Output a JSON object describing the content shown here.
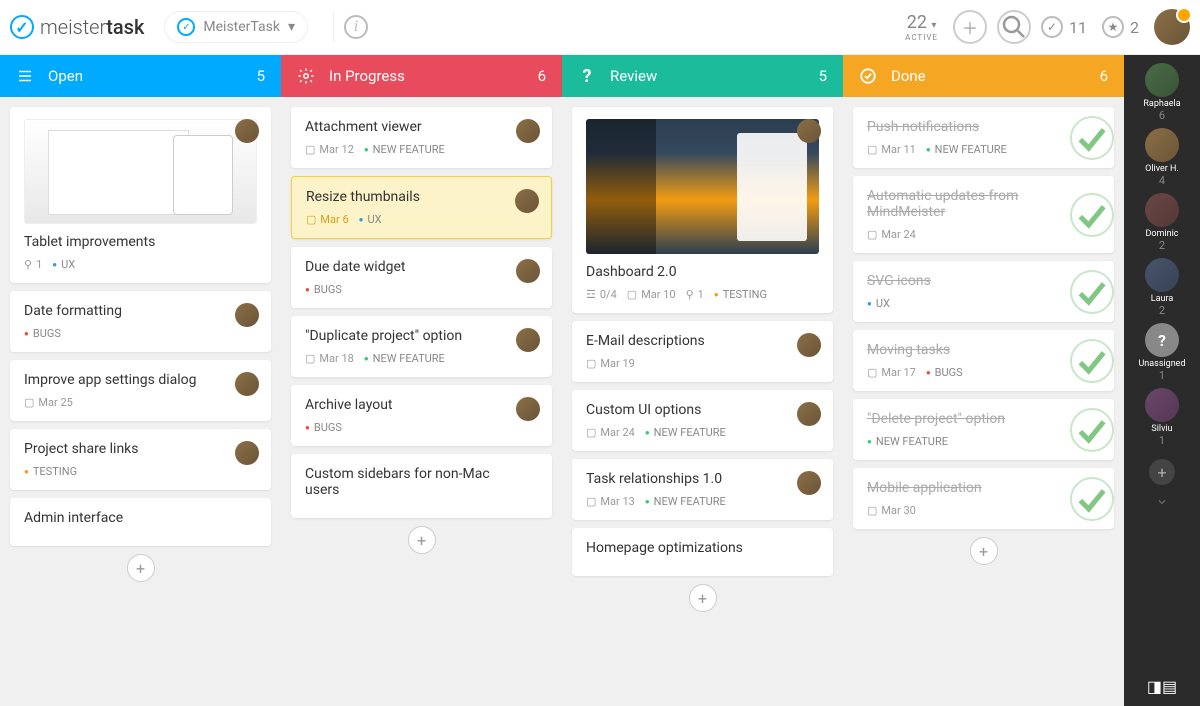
{
  "header": {
    "logo_pre": "meister",
    "logo_post": "task",
    "project_name": "MeisterTask",
    "active_count": "22",
    "active_label": "ACTIVE",
    "done_count": "11",
    "star_count": "2"
  },
  "columns": [
    {
      "title": "Open",
      "count": "5",
      "color": "#00aaff",
      "icon": "list",
      "cards": [
        {
          "title": "Tablet improvements",
          "img": "devices",
          "attach": "1",
          "tags": [
            "UX"
          ],
          "av": "av-c1"
        },
        {
          "title": "Date formatting",
          "tags": [
            "BUGS"
          ],
          "av": "av-c1"
        },
        {
          "title": "Improve app settings dialog",
          "date": "Mar 25",
          "av": "av-c1"
        },
        {
          "title": "Project share links",
          "tags": [
            "TESTING"
          ],
          "av": "av-c1"
        },
        {
          "title": "Admin interface"
        }
      ]
    },
    {
      "title": "In Progress",
      "count": "6",
      "color": "#e84c5c",
      "icon": "gear",
      "cards": [
        {
          "title": "Attachment viewer",
          "date": "Mar 12",
          "tags": [
            "NEW FEATURE"
          ],
          "av": "av-c1"
        },
        {
          "title": "Resize thumbnails",
          "date": "Mar 6",
          "tags": [
            "UX"
          ],
          "av": "av-c1",
          "hl": true
        },
        {
          "title": "Due date widget",
          "tags": [
            "BUGS"
          ],
          "av": "av-c1"
        },
        {
          "title": "\"Duplicate project\" option",
          "date": "Mar 18",
          "tags": [
            "NEW FEATURE"
          ],
          "av": "av-c1"
        },
        {
          "title": "Archive layout",
          "tags": [
            "BUGS"
          ],
          "av": "av-c1"
        },
        {
          "title": "Custom sidebars for non-Mac users"
        }
      ]
    },
    {
      "title": "Review",
      "count": "5",
      "color": "#1abc9c",
      "icon": "question",
      "cards": [
        {
          "title": "Dashboard 2.0",
          "img": "dashboard",
          "check": "0/4",
          "date": "Mar 10",
          "attach": "1",
          "tags": [
            "TESTING"
          ],
          "av": "av-c1"
        },
        {
          "title": "E-Mail descriptions",
          "date": "Mar 19",
          "av": "av-c1"
        },
        {
          "title": "Custom UI options",
          "date": "Mar 24",
          "tags": [
            "NEW FEATURE"
          ],
          "av": "av-c1"
        },
        {
          "title": "Task relationships 1.0",
          "date": "Mar 13",
          "tags": [
            "NEW FEATURE"
          ],
          "av": "av-c1"
        },
        {
          "title": "Homepage optimizations"
        }
      ]
    },
    {
      "title": "Done",
      "count": "6",
      "color": "#f5a623",
      "icon": "check",
      "cards": [
        {
          "title": "Push notifications",
          "date": "Mar 11",
          "tags": [
            "NEW FEATURE"
          ],
          "done": true
        },
        {
          "title": "Automatic updates from MindMeister",
          "date": "Mar 24",
          "done": true
        },
        {
          "title": "SVG icons",
          "tags": [
            "UX"
          ],
          "done": true
        },
        {
          "title": "Moving tasks",
          "date": "Mar 17",
          "tags": [
            "BUGS"
          ],
          "done": true
        },
        {
          "title": "\"Delete project\" option",
          "tags": [
            "NEW FEATURE"
          ],
          "done": true
        },
        {
          "title": "Mobile application",
          "date": "Mar 30",
          "done": true
        }
      ]
    }
  ],
  "sidebar": [
    {
      "name": "Raphaela",
      "count": "6",
      "av": "av-c2"
    },
    {
      "name": "Oliver H.",
      "count": "4",
      "av": "av-c1"
    },
    {
      "name": "Dominic",
      "count": "2",
      "av": "av-c3"
    },
    {
      "name": "Laura",
      "count": "2",
      "av": "av-c4"
    },
    {
      "name": "Unassigned",
      "count": "1",
      "av": "av-un",
      "unassigned": true
    },
    {
      "name": "Silviu",
      "count": "1",
      "av": "av-c5"
    }
  ]
}
